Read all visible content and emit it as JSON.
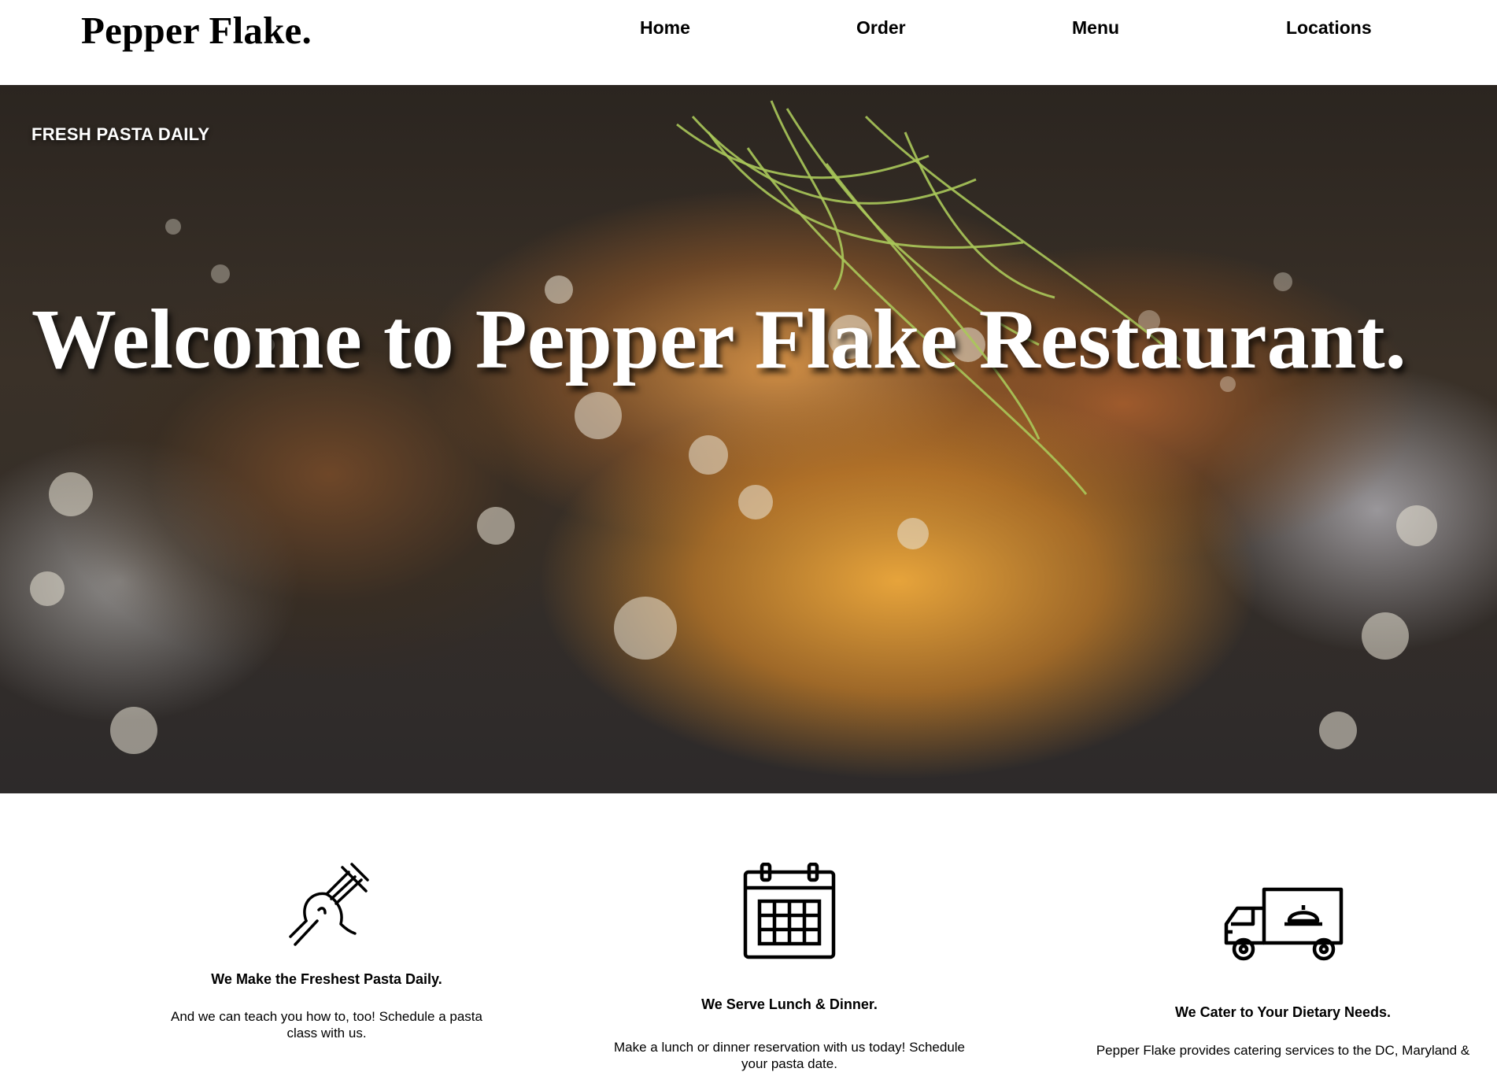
{
  "header": {
    "logo": "Pepper Flake.",
    "nav": {
      "home": "Home",
      "order": "Order",
      "menu": "Menu",
      "locations": "Locations"
    }
  },
  "hero": {
    "tagline": "FRESH PASTA DAILY",
    "title": "Welcome to Pepper Flake Restaurant."
  },
  "features": [
    {
      "icon": "pasta-fork-icon",
      "heading": "We Make the Freshest Pasta Daily.",
      "text": "And we can teach you how to, too! Schedule a pasta class with us."
    },
    {
      "icon": "calendar-icon",
      "heading": "We Serve Lunch & Dinner.",
      "text": "Make a lunch or dinner reservation with us today! Schedule your pasta date."
    },
    {
      "icon": "catering-truck-icon",
      "heading": "We Cater to Your Dietary Needs.",
      "text": "Pepper Flake provides catering services to the DC, Maryland &"
    }
  ]
}
